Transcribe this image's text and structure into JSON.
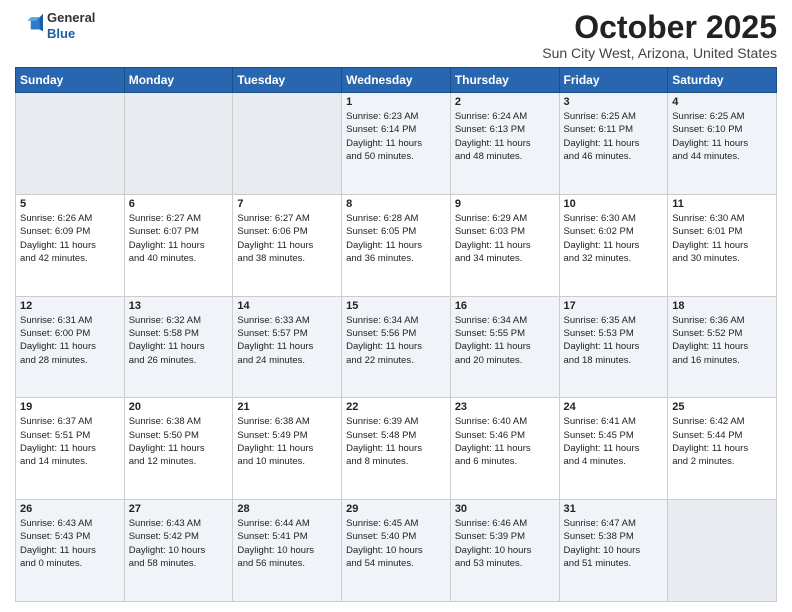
{
  "header": {
    "logo_general": "General",
    "logo_blue": "Blue",
    "month_title": "October 2025",
    "location": "Sun City West, Arizona, United States"
  },
  "weekdays": [
    "Sunday",
    "Monday",
    "Tuesday",
    "Wednesday",
    "Thursday",
    "Friday",
    "Saturday"
  ],
  "weeks": [
    [
      {
        "day": "",
        "info": ""
      },
      {
        "day": "",
        "info": ""
      },
      {
        "day": "",
        "info": ""
      },
      {
        "day": "1",
        "info": "Sunrise: 6:23 AM\nSunset: 6:14 PM\nDaylight: 11 hours\nand 50 minutes."
      },
      {
        "day": "2",
        "info": "Sunrise: 6:24 AM\nSunset: 6:13 PM\nDaylight: 11 hours\nand 48 minutes."
      },
      {
        "day": "3",
        "info": "Sunrise: 6:25 AM\nSunset: 6:11 PM\nDaylight: 11 hours\nand 46 minutes."
      },
      {
        "day": "4",
        "info": "Sunrise: 6:25 AM\nSunset: 6:10 PM\nDaylight: 11 hours\nand 44 minutes."
      }
    ],
    [
      {
        "day": "5",
        "info": "Sunrise: 6:26 AM\nSunset: 6:09 PM\nDaylight: 11 hours\nand 42 minutes."
      },
      {
        "day": "6",
        "info": "Sunrise: 6:27 AM\nSunset: 6:07 PM\nDaylight: 11 hours\nand 40 minutes."
      },
      {
        "day": "7",
        "info": "Sunrise: 6:27 AM\nSunset: 6:06 PM\nDaylight: 11 hours\nand 38 minutes."
      },
      {
        "day": "8",
        "info": "Sunrise: 6:28 AM\nSunset: 6:05 PM\nDaylight: 11 hours\nand 36 minutes."
      },
      {
        "day": "9",
        "info": "Sunrise: 6:29 AM\nSunset: 6:03 PM\nDaylight: 11 hours\nand 34 minutes."
      },
      {
        "day": "10",
        "info": "Sunrise: 6:30 AM\nSunset: 6:02 PM\nDaylight: 11 hours\nand 32 minutes."
      },
      {
        "day": "11",
        "info": "Sunrise: 6:30 AM\nSunset: 6:01 PM\nDaylight: 11 hours\nand 30 minutes."
      }
    ],
    [
      {
        "day": "12",
        "info": "Sunrise: 6:31 AM\nSunset: 6:00 PM\nDaylight: 11 hours\nand 28 minutes."
      },
      {
        "day": "13",
        "info": "Sunrise: 6:32 AM\nSunset: 5:58 PM\nDaylight: 11 hours\nand 26 minutes."
      },
      {
        "day": "14",
        "info": "Sunrise: 6:33 AM\nSunset: 5:57 PM\nDaylight: 11 hours\nand 24 minutes."
      },
      {
        "day": "15",
        "info": "Sunrise: 6:34 AM\nSunset: 5:56 PM\nDaylight: 11 hours\nand 22 minutes."
      },
      {
        "day": "16",
        "info": "Sunrise: 6:34 AM\nSunset: 5:55 PM\nDaylight: 11 hours\nand 20 minutes."
      },
      {
        "day": "17",
        "info": "Sunrise: 6:35 AM\nSunset: 5:53 PM\nDaylight: 11 hours\nand 18 minutes."
      },
      {
        "day": "18",
        "info": "Sunrise: 6:36 AM\nSunset: 5:52 PM\nDaylight: 11 hours\nand 16 minutes."
      }
    ],
    [
      {
        "day": "19",
        "info": "Sunrise: 6:37 AM\nSunset: 5:51 PM\nDaylight: 11 hours\nand 14 minutes."
      },
      {
        "day": "20",
        "info": "Sunrise: 6:38 AM\nSunset: 5:50 PM\nDaylight: 11 hours\nand 12 minutes."
      },
      {
        "day": "21",
        "info": "Sunrise: 6:38 AM\nSunset: 5:49 PM\nDaylight: 11 hours\nand 10 minutes."
      },
      {
        "day": "22",
        "info": "Sunrise: 6:39 AM\nSunset: 5:48 PM\nDaylight: 11 hours\nand 8 minutes."
      },
      {
        "day": "23",
        "info": "Sunrise: 6:40 AM\nSunset: 5:46 PM\nDaylight: 11 hours\nand 6 minutes."
      },
      {
        "day": "24",
        "info": "Sunrise: 6:41 AM\nSunset: 5:45 PM\nDaylight: 11 hours\nand 4 minutes."
      },
      {
        "day": "25",
        "info": "Sunrise: 6:42 AM\nSunset: 5:44 PM\nDaylight: 11 hours\nand 2 minutes."
      }
    ],
    [
      {
        "day": "26",
        "info": "Sunrise: 6:43 AM\nSunset: 5:43 PM\nDaylight: 11 hours\nand 0 minutes."
      },
      {
        "day": "27",
        "info": "Sunrise: 6:43 AM\nSunset: 5:42 PM\nDaylight: 10 hours\nand 58 minutes."
      },
      {
        "day": "28",
        "info": "Sunrise: 6:44 AM\nSunset: 5:41 PM\nDaylight: 10 hours\nand 56 minutes."
      },
      {
        "day": "29",
        "info": "Sunrise: 6:45 AM\nSunset: 5:40 PM\nDaylight: 10 hours\nand 54 minutes."
      },
      {
        "day": "30",
        "info": "Sunrise: 6:46 AM\nSunset: 5:39 PM\nDaylight: 10 hours\nand 53 minutes."
      },
      {
        "day": "31",
        "info": "Sunrise: 6:47 AM\nSunset: 5:38 PM\nDaylight: 10 hours\nand 51 minutes."
      },
      {
        "day": "",
        "info": ""
      }
    ]
  ]
}
